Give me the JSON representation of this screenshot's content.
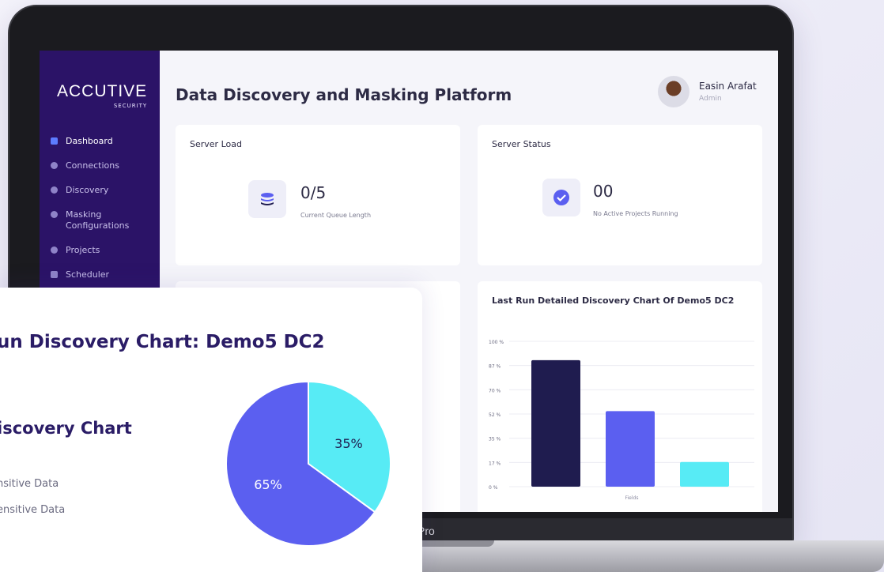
{
  "app": {
    "brand": "ACCUTIVE",
    "brand_sub": "SECURITY",
    "page_title": "Data Discovery and Masking Platform",
    "device_label": "Pro"
  },
  "user": {
    "name": "Easin Arafat",
    "role": "Admin"
  },
  "sidebar": {
    "items": [
      {
        "label": "Dashboard",
        "icon": "dashboard-icon",
        "active": true
      },
      {
        "label": "Connections",
        "icon": "plug-icon",
        "active": false
      },
      {
        "label": "Discovery",
        "icon": "discovery-icon",
        "active": false
      },
      {
        "label": "Masking Configurations",
        "icon": "masking-icon",
        "active": false
      },
      {
        "label": "Projects",
        "icon": "projects-icon",
        "active": false
      },
      {
        "label": "Scheduler",
        "icon": "calendar-icon",
        "active": false
      }
    ]
  },
  "server_load": {
    "title": "Server Load",
    "value": "0/5",
    "caption": "Current Queue Length",
    "icon": "database-icon"
  },
  "server_status": {
    "title": "Server Status",
    "value": "00",
    "caption": "No Active Projects Running",
    "icon": "check-circle-icon"
  },
  "bar_card": {
    "title": "Last Run Detailed Discovery Chart Of Demo5 DC2"
  },
  "pie_card": {
    "title": "un Discovery Chart: Demo5 DC2",
    "subtitle": "iscovery Chart",
    "legend": [
      "nsitive Data",
      "ensitive Data"
    ]
  },
  "colors": {
    "sidebar": "#2b1367",
    "accent": "#5b5ff0",
    "navy": "#1f1c4f",
    "cyan": "#57ebf5"
  },
  "chart_data": [
    {
      "type": "bar",
      "title": "Last Run Detailed Discovery Chart Of Demo5 DC2",
      "xlabel": "Fields",
      "ylabel": "",
      "yticks": [
        "100 %",
        "87 %",
        "70 %",
        "52 %",
        "35 %",
        "17 %",
        "0 %"
      ],
      "ylim": [
        0,
        100
      ],
      "values": [
        87,
        52,
        17
      ],
      "colors": [
        "#1f1c4f",
        "#5b5ff0",
        "#57ebf5"
      ],
      "grid": true
    },
    {
      "type": "pie",
      "title": "un Discovery Chart: Demo5 DC2",
      "slices": [
        {
          "value": 35,
          "label": "35%",
          "color": "#57ebf5"
        },
        {
          "value": 65,
          "label": "65%",
          "color": "#5b5ff0"
        }
      ]
    }
  ]
}
